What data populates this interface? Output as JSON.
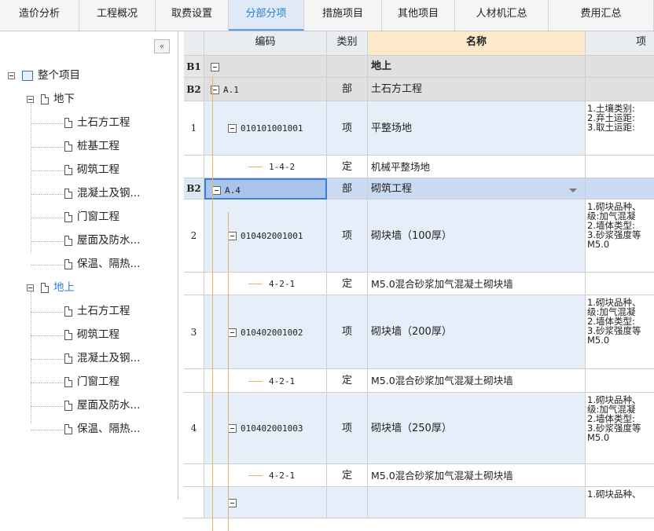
{
  "tabs": [
    {
      "label": "造价分析"
    },
    {
      "label": "工程概况"
    },
    {
      "label": "取费设置"
    },
    {
      "label": "分部分项",
      "active": true
    },
    {
      "label": "措施项目"
    },
    {
      "label": "其他项目"
    },
    {
      "label": "人材机汇总"
    },
    {
      "label": "费用汇总"
    }
  ],
  "tree": {
    "collapse_glyph": "«",
    "root": "整个项目",
    "section_a": "地下",
    "section_a_children": [
      "土石方工程",
      "桩基工程",
      "砌筑工程",
      "混凝土及钢...",
      "门窗工程",
      "屋面及防水...",
      "保温、隔热..."
    ],
    "section_b": "地上",
    "section_b_children": [
      "土石方工程",
      "砌筑工程",
      "混凝土及钢...",
      "门窗工程",
      "屋面及防水...",
      "保温、隔热..."
    ]
  },
  "columns": {
    "code": "编码",
    "type": "类别",
    "name": "名称",
    "feature": "项"
  },
  "rows": [
    {
      "num": "B1",
      "code": "",
      "type": "",
      "name": "地上",
      "desc": ""
    },
    {
      "num": "B2",
      "code": "A.1",
      "type": "部",
      "name": "土石方工程",
      "desc": ""
    },
    {
      "num": "1",
      "code": "010101001001",
      "type": "项",
      "name": "平整场地",
      "desc": "1.土壤类别:\n2.弃土运距:\n3.取土运距:"
    },
    {
      "num": "",
      "code": "1-4-2",
      "type": "定",
      "name": "机械平整场地",
      "desc": ""
    },
    {
      "num": "B2",
      "code": "A.4",
      "type": "部",
      "name": "砌筑工程",
      "desc": ""
    },
    {
      "num": "2",
      "code": "010402001001",
      "type": "项",
      "name": "砌块墙（100厚）",
      "desc": "1.砌块品种、\n级:加气混凝\n2.墙体类型:\n3.砂浆强度等\nM5.0"
    },
    {
      "num": "",
      "code": "4-2-1",
      "type": "定",
      "name": "M5.0混合砂浆加气混凝土砌块墙",
      "desc": ""
    },
    {
      "num": "3",
      "code": "010402001002",
      "type": "项",
      "name": "砌块墙（200厚）",
      "desc": "1.砌块品种、\n级:加气混凝\n2.墙体类型:\n3.砂浆强度等\nM5.0"
    },
    {
      "num": "",
      "code": "4-2-1",
      "type": "定",
      "name": "M5.0混合砂浆加气混凝土砌块墙",
      "desc": ""
    },
    {
      "num": "4",
      "code": "010402001003",
      "type": "项",
      "name": "砌块墙（250厚）",
      "desc": "1.砌块品种、\n级:加气混凝\n2.墙体类型:\n3.砂浆强度等\nM5.0"
    },
    {
      "num": "",
      "code": "4-2-1",
      "type": "定",
      "name": "M5.0混合砂浆加气混凝土砌块墙",
      "desc": ""
    },
    {
      "num": "",
      "code": "",
      "type": "",
      "name": "",
      "desc": "1.砌块品种、"
    }
  ],
  "colors": {
    "accent": "#2a7fd4",
    "header_bg": "#e9ecf0",
    "group_bg": "#e0e0e0",
    "item_bg": "#e6eef9",
    "selected_bg": "#a9c4ea",
    "name_header": "#fbe9c9"
  }
}
